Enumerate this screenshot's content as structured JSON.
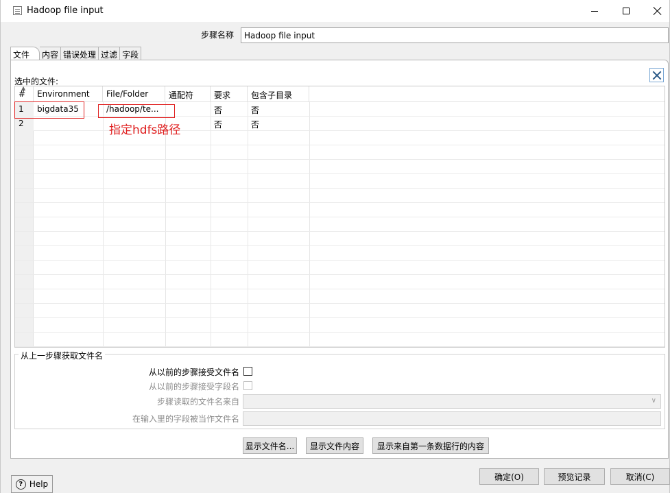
{
  "window": {
    "title": "Hadoop file input"
  },
  "step_name": {
    "label": "步骤名称",
    "value": "Hadoop file input"
  },
  "tabs": [
    "文件",
    "内容",
    "错误处理",
    "过滤",
    "字段"
  ],
  "files_section": {
    "label": "选中的文件:"
  },
  "grid": {
    "columns": [
      "#",
      "Environment",
      "File/Folder",
      "通配符",
      "要求",
      "包含子目录"
    ],
    "rows": [
      {
        "num": "1",
        "environment": "bigdata35",
        "file": "/hadoop/te...",
        "wildcard": "",
        "required": "否",
        "subdirs": "否"
      },
      {
        "num": "2",
        "environment": "",
        "file": "",
        "wildcard": "",
        "required": "否",
        "subdirs": "否"
      }
    ]
  },
  "annotation": "指定hdfs路径",
  "prev_step_group": {
    "title": "从上一步骤获取文件名",
    "accept_filenames_label": "从以前的步骤接受文件名",
    "accept_fields_label": "从以前的步骤接受字段名",
    "step_source_label": "步骤读取的文件名来自",
    "field_as_filename_label": "在输入里的字段被当作文件名"
  },
  "buttons": {
    "show_filenames": "显示文件名...",
    "show_file_content": "显示文件内容",
    "show_first_row": "显示来自第一条数据行的内容",
    "help": "Help",
    "ok": "确定(O)",
    "preview": "预览记录",
    "cancel": "取消(C)"
  },
  "colors": {
    "annotation_red": "#e02020",
    "close_x": "#2b5a88"
  }
}
